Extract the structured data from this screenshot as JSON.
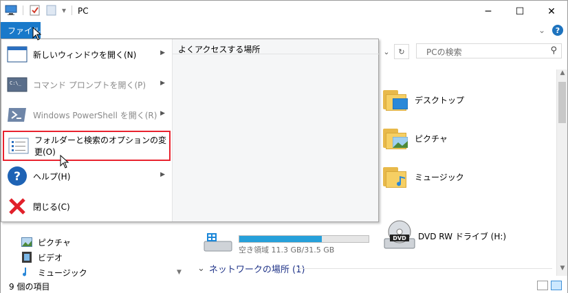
{
  "window": {
    "title": "PC"
  },
  "ribbon": {
    "file_tab": "ファイル"
  },
  "search": {
    "placeholder": "PCの検索"
  },
  "file_menu": {
    "items": [
      {
        "label": "新しいウィンドウを開く(N)",
        "icon": "window-icon",
        "has_submenu": true,
        "enabled": true
      },
      {
        "label": "コマンド プロンプトを開く(P)",
        "icon": "cmd-icon",
        "has_submenu": true,
        "enabled": false
      },
      {
        "label": "Windows PowerShell を開く(R)",
        "icon": "powershell-icon",
        "has_submenu": true,
        "enabled": false
      },
      {
        "label": "フォルダーと検索のオプションの変更(O)",
        "icon": "options-icon",
        "has_submenu": false,
        "enabled": true,
        "highlighted": true
      },
      {
        "label": "ヘルプ(H)",
        "icon": "help-icon",
        "has_submenu": true,
        "enabled": true
      },
      {
        "label": "閉じる(C)",
        "icon": "close-x-icon",
        "has_submenu": false,
        "enabled": true
      }
    ],
    "frequent_places_title": "よくアクセスする場所"
  },
  "content": {
    "folders": [
      {
        "label": "デスクトップ",
        "icon": "desktop-folder-icon"
      },
      {
        "label": "ピクチャ",
        "icon": "pictures-folder-icon"
      },
      {
        "label": "ミュージック",
        "icon": "music-folder-icon"
      }
    ],
    "drive": {
      "label": "空き領域 11.3 GB/31.5 GB",
      "used_fraction": 0.64
    },
    "dvd": {
      "label": "DVD RW ドライブ (H:)"
    },
    "network_group": "ネットワークの場所 (1)"
  },
  "nav_pane": {
    "items": [
      {
        "label": "ピクチャ",
        "icon": "pictures-icon"
      },
      {
        "label": "ビデオ",
        "icon": "video-icon"
      },
      {
        "label": "ミュージック",
        "icon": "music-icon"
      }
    ]
  },
  "status": {
    "item_count": "9 個の項目"
  },
  "colors": {
    "accent": "#1979ca",
    "highlight_border": "#e8212d",
    "progress": "#26a0da"
  }
}
